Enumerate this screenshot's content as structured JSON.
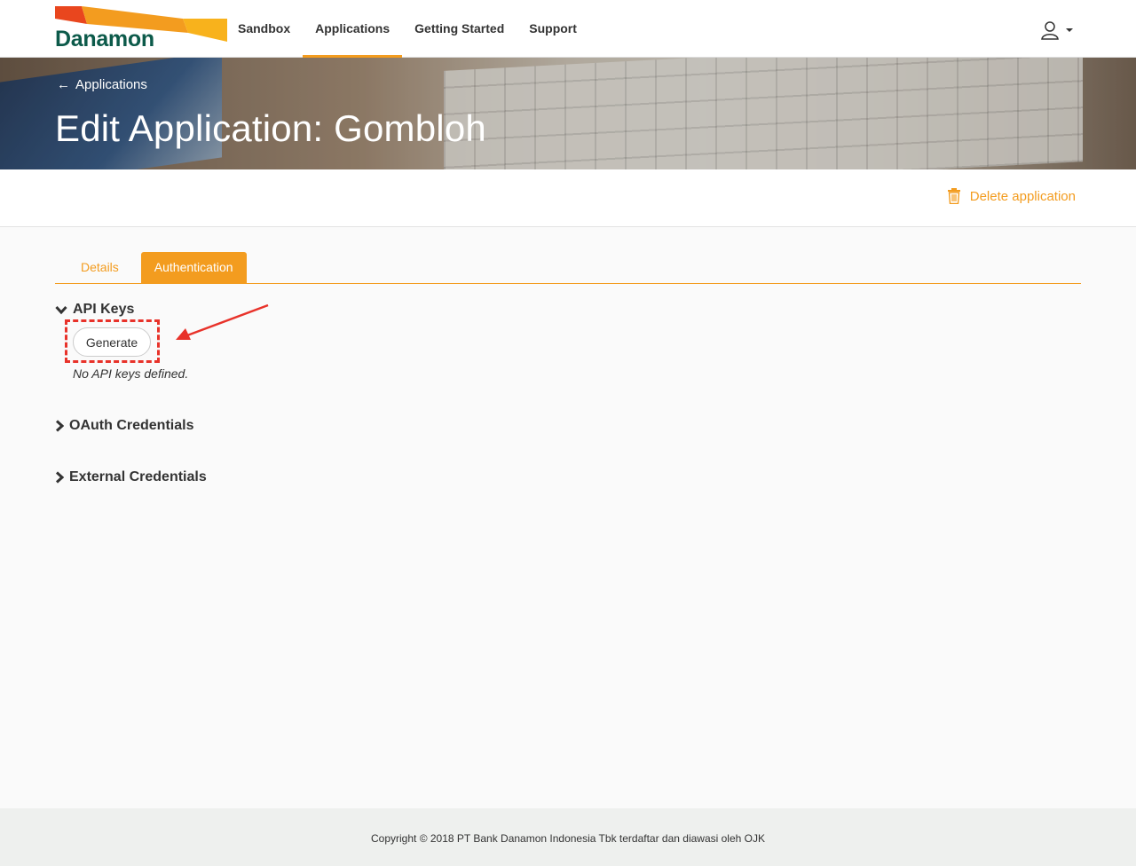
{
  "brand": {
    "name": "Danamon",
    "colors": {
      "primary": "#f39c1f",
      "logo_green": "#0c5a4a",
      "logo_red": "#e9461e",
      "highlight": "#e8322a"
    }
  },
  "nav": {
    "items": [
      {
        "label": "Sandbox",
        "active": false
      },
      {
        "label": "Applications",
        "active": true
      },
      {
        "label": "Getting Started",
        "active": false
      },
      {
        "label": "Support",
        "active": false
      }
    ],
    "user_icon": "user-icon"
  },
  "hero": {
    "breadcrumb": "Applications",
    "title": "Edit Application: Gombloh"
  },
  "actions": {
    "delete_label": "Delete application",
    "delete_icon": "trash-icon"
  },
  "tabs": [
    {
      "label": "Details",
      "active": false
    },
    {
      "label": "Authentication",
      "active": true
    }
  ],
  "sections": {
    "api_keys": {
      "title": "API Keys",
      "expanded": true,
      "generate_label": "Generate",
      "empty_text": "No API keys defined."
    },
    "oauth": {
      "title": "OAuth Credentials",
      "expanded": false
    },
    "external": {
      "title": "External Credentials",
      "expanded": false
    }
  },
  "footer": {
    "copyright": "Copyright © 2018 PT Bank Danamon Indonesia Tbk terdaftar dan diawasi oleh OJK"
  }
}
